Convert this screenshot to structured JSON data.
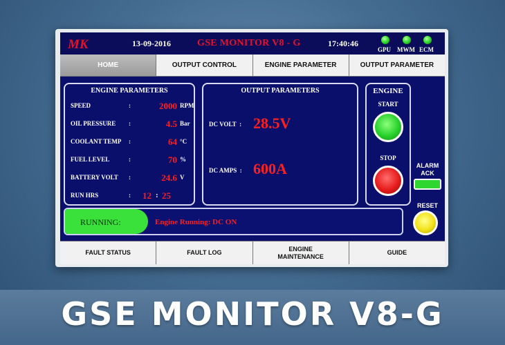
{
  "header": {
    "logo_text": "MK",
    "date": "13-09-2016",
    "title": "GSE MONITOR V8 - G",
    "time": "17:40:46",
    "indicators": [
      {
        "label": "GPU",
        "color": "#2edb2c"
      },
      {
        "label": "MWM",
        "color": "#2edb2c"
      },
      {
        "label": "ECM",
        "color": "#2edb2c"
      }
    ]
  },
  "tabs": [
    "HOME",
    "OUTPUT CONTROL",
    "ENGINE PARAMETER",
    "OUTPUT PARAMETER"
  ],
  "engine_params": {
    "title": "ENGINE PARAMETERS",
    "rows": [
      {
        "label": "SPEED",
        "value": "2000",
        "unit": "RPM"
      },
      {
        "label": "OIL PRESSURE",
        "value": "4.5",
        "unit": "Bar"
      },
      {
        "label": "COOLANT TEMP",
        "value": "64",
        "unit": "°C"
      },
      {
        "label": "FUEL LEVEL",
        "value": "70",
        "unit": "%"
      },
      {
        "label": "BATTERY VOLT",
        "value": "24.6",
        "unit": "V"
      }
    ],
    "run_hrs": {
      "label": "RUN HRS",
      "hours": "12",
      "minutes": "25"
    },
    "colon": ":"
  },
  "output_params": {
    "title": "OUTPUT PARAMETERS",
    "dc_volt_label": "DC VOLT",
    "dc_volt_value": "28.5V",
    "dc_amps_label": "DC AMPS",
    "dc_amps_value": "600A"
  },
  "engine_controls": {
    "title": "ENGINE",
    "start_label": "START",
    "stop_label": "STOP"
  },
  "alarm": {
    "line1": "ALARM",
    "line2": "ACK"
  },
  "reset_label": "RESET",
  "status": {
    "label": "RUNNING:",
    "message": "Engine Running: DC ON"
  },
  "bottom_tabs": [
    {
      "line1": "FAULT STATUS",
      "line2": ""
    },
    {
      "line1": "FAULT LOG",
      "line2": ""
    },
    {
      "line1": "ENGINE",
      "line2": "MAINTENANCE"
    },
    {
      "line1": "GUIDE",
      "line2": ""
    }
  ],
  "banner": "GSE MONITOR V8-G",
  "colors": {
    "screen_bg": "#0a0f6b",
    "value_red": "#ff1e1e",
    "title_red": "#e8102a",
    "running_green": "#39e13a"
  }
}
